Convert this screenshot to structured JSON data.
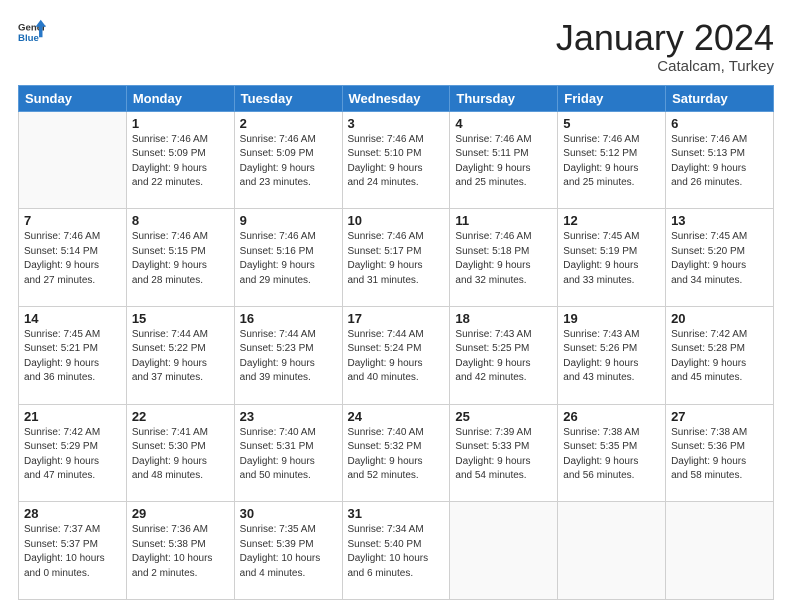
{
  "logo": {
    "general": "General",
    "blue": "Blue"
  },
  "header": {
    "month": "January 2024",
    "location": "Catalcam, Turkey"
  },
  "weekdays": [
    "Sunday",
    "Monday",
    "Tuesday",
    "Wednesday",
    "Thursday",
    "Friday",
    "Saturday"
  ],
  "weeks": [
    [
      {
        "day": "",
        "info": ""
      },
      {
        "day": "1",
        "info": "Sunrise: 7:46 AM\nSunset: 5:09 PM\nDaylight: 9 hours\nand 22 minutes."
      },
      {
        "day": "2",
        "info": "Sunrise: 7:46 AM\nSunset: 5:09 PM\nDaylight: 9 hours\nand 23 minutes."
      },
      {
        "day": "3",
        "info": "Sunrise: 7:46 AM\nSunset: 5:10 PM\nDaylight: 9 hours\nand 24 minutes."
      },
      {
        "day": "4",
        "info": "Sunrise: 7:46 AM\nSunset: 5:11 PM\nDaylight: 9 hours\nand 25 minutes."
      },
      {
        "day": "5",
        "info": "Sunrise: 7:46 AM\nSunset: 5:12 PM\nDaylight: 9 hours\nand 25 minutes."
      },
      {
        "day": "6",
        "info": "Sunrise: 7:46 AM\nSunset: 5:13 PM\nDaylight: 9 hours\nand 26 minutes."
      }
    ],
    [
      {
        "day": "7",
        "info": "Sunrise: 7:46 AM\nSunset: 5:14 PM\nDaylight: 9 hours\nand 27 minutes."
      },
      {
        "day": "8",
        "info": "Sunrise: 7:46 AM\nSunset: 5:15 PM\nDaylight: 9 hours\nand 28 minutes."
      },
      {
        "day": "9",
        "info": "Sunrise: 7:46 AM\nSunset: 5:16 PM\nDaylight: 9 hours\nand 29 minutes."
      },
      {
        "day": "10",
        "info": "Sunrise: 7:46 AM\nSunset: 5:17 PM\nDaylight: 9 hours\nand 31 minutes."
      },
      {
        "day": "11",
        "info": "Sunrise: 7:46 AM\nSunset: 5:18 PM\nDaylight: 9 hours\nand 32 minutes."
      },
      {
        "day": "12",
        "info": "Sunrise: 7:45 AM\nSunset: 5:19 PM\nDaylight: 9 hours\nand 33 minutes."
      },
      {
        "day": "13",
        "info": "Sunrise: 7:45 AM\nSunset: 5:20 PM\nDaylight: 9 hours\nand 34 minutes."
      }
    ],
    [
      {
        "day": "14",
        "info": "Sunrise: 7:45 AM\nSunset: 5:21 PM\nDaylight: 9 hours\nand 36 minutes."
      },
      {
        "day": "15",
        "info": "Sunrise: 7:44 AM\nSunset: 5:22 PM\nDaylight: 9 hours\nand 37 minutes."
      },
      {
        "day": "16",
        "info": "Sunrise: 7:44 AM\nSunset: 5:23 PM\nDaylight: 9 hours\nand 39 minutes."
      },
      {
        "day": "17",
        "info": "Sunrise: 7:44 AM\nSunset: 5:24 PM\nDaylight: 9 hours\nand 40 minutes."
      },
      {
        "day": "18",
        "info": "Sunrise: 7:43 AM\nSunset: 5:25 PM\nDaylight: 9 hours\nand 42 minutes."
      },
      {
        "day": "19",
        "info": "Sunrise: 7:43 AM\nSunset: 5:26 PM\nDaylight: 9 hours\nand 43 minutes."
      },
      {
        "day": "20",
        "info": "Sunrise: 7:42 AM\nSunset: 5:28 PM\nDaylight: 9 hours\nand 45 minutes."
      }
    ],
    [
      {
        "day": "21",
        "info": "Sunrise: 7:42 AM\nSunset: 5:29 PM\nDaylight: 9 hours\nand 47 minutes."
      },
      {
        "day": "22",
        "info": "Sunrise: 7:41 AM\nSunset: 5:30 PM\nDaylight: 9 hours\nand 48 minutes."
      },
      {
        "day": "23",
        "info": "Sunrise: 7:40 AM\nSunset: 5:31 PM\nDaylight: 9 hours\nand 50 minutes."
      },
      {
        "day": "24",
        "info": "Sunrise: 7:40 AM\nSunset: 5:32 PM\nDaylight: 9 hours\nand 52 minutes."
      },
      {
        "day": "25",
        "info": "Sunrise: 7:39 AM\nSunset: 5:33 PM\nDaylight: 9 hours\nand 54 minutes."
      },
      {
        "day": "26",
        "info": "Sunrise: 7:38 AM\nSunset: 5:35 PM\nDaylight: 9 hours\nand 56 minutes."
      },
      {
        "day": "27",
        "info": "Sunrise: 7:38 AM\nSunset: 5:36 PM\nDaylight: 9 hours\nand 58 minutes."
      }
    ],
    [
      {
        "day": "28",
        "info": "Sunrise: 7:37 AM\nSunset: 5:37 PM\nDaylight: 10 hours\nand 0 minutes."
      },
      {
        "day": "29",
        "info": "Sunrise: 7:36 AM\nSunset: 5:38 PM\nDaylight: 10 hours\nand 2 minutes."
      },
      {
        "day": "30",
        "info": "Sunrise: 7:35 AM\nSunset: 5:39 PM\nDaylight: 10 hours\nand 4 minutes."
      },
      {
        "day": "31",
        "info": "Sunrise: 7:34 AM\nSunset: 5:40 PM\nDaylight: 10 hours\nand 6 minutes."
      },
      {
        "day": "",
        "info": ""
      },
      {
        "day": "",
        "info": ""
      },
      {
        "day": "",
        "info": ""
      }
    ]
  ]
}
